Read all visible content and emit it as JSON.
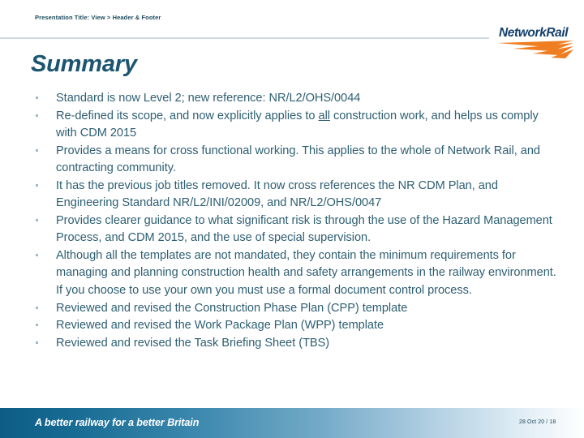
{
  "header": {
    "placeholder_text": "Presentation Title: View > Header & Footer"
  },
  "logo": {
    "wordmark": "NetworkRail",
    "swoosh_color": "#ef7d22",
    "wordmark_color": "#13406b"
  },
  "title": "Summary",
  "bullets": [
    {
      "segments": [
        {
          "text": "Standard is now Level 2; new reference:  NR/L2/OHS/0044",
          "underline": false
        }
      ]
    },
    {
      "segments": [
        {
          "text": "Re-defined its scope, and now explicitly applies to ",
          "underline": false
        },
        {
          "text": "all",
          "underline": true
        },
        {
          "text": " construction work, and helps us comply with CDM 2015",
          "underline": false
        }
      ]
    },
    {
      "segments": [
        {
          "text": "Provides a means for cross functional working.  This applies to the whole of Network Rail, and contracting community.",
          "underline": false
        }
      ]
    },
    {
      "segments": [
        {
          "text": "It has the previous job titles removed.  It now cross references the NR CDM Plan, and Engineering Standard NR/L2/INI/02009, and NR/L2/OHS/0047",
          "underline": false
        }
      ]
    },
    {
      "segments": [
        {
          "text": "Provides clearer guidance to what significant risk is through the use of the Hazard Management Process, and CDM 2015, and the use of special supervision.",
          "underline": false
        }
      ]
    },
    {
      "segments": [
        {
          "text": "Although all the templates are not mandated, they contain the minimum requirements for managing and planning construction health and safety arrangements in the railway environment.  If you choose to use your own you must use a formal document control process.",
          "underline": false
        }
      ]
    },
    {
      "segments": [
        {
          "text": "Reviewed and revised the Construction Phase Plan (CPP) template",
          "underline": false
        }
      ]
    },
    {
      "segments": [
        {
          "text": "Reviewed and revised the Work Package Plan (WPP) template",
          "underline": false
        }
      ]
    },
    {
      "segments": [
        {
          "text": "Reviewed and revised the Task Briefing Sheet (TBS)",
          "underline": false
        }
      ]
    }
  ],
  "footer": {
    "tagline": "A better railway for a better Britain",
    "date": "28 Oct 20",
    "separator": "/",
    "slide_number": "18",
    "meta": "28 Oct 20  /  18"
  },
  "colors": {
    "title": "#1b5570",
    "body_text": "#2e5f72",
    "header_text": "#1b4b5e",
    "rule": "#cdd9e0",
    "bullet_marker": "#9fb9c6",
    "footer_gradient_start": "#0d5c86",
    "footer_gradient_end": "#ffffff",
    "brand_orange": "#ef7d22"
  }
}
